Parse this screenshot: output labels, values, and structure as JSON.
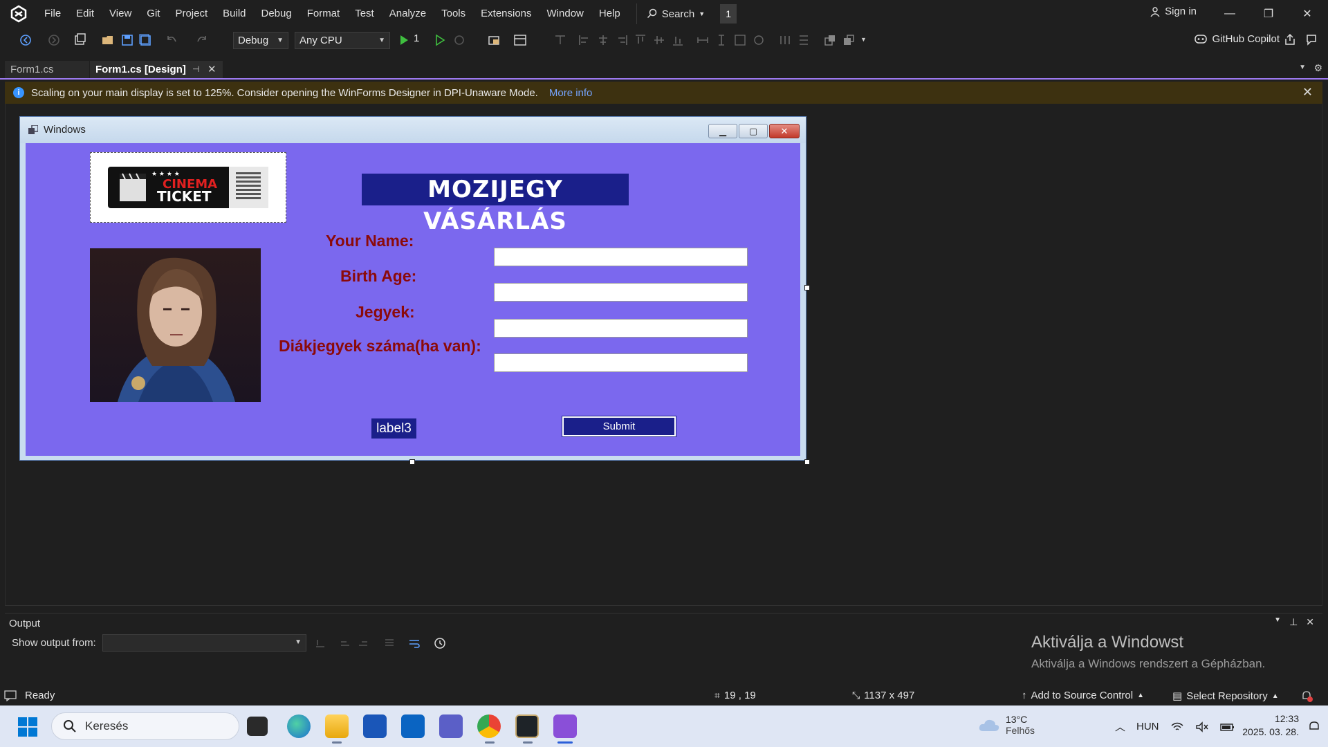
{
  "menubar": {
    "items": [
      "File",
      "Edit",
      "View",
      "Git",
      "Project",
      "Build",
      "Debug",
      "Format",
      "Test",
      "Analyze",
      "Tools",
      "Extensions",
      "Window",
      "Help"
    ],
    "search_label": "Search",
    "badge": "1",
    "signin": "Sign in"
  },
  "toolbar": {
    "config": "Debug",
    "platform": "Any CPU",
    "run_count": "1",
    "copilot": "GitHub Copilot"
  },
  "tabs": [
    {
      "label": "Form1.cs",
      "active": false
    },
    {
      "label": "Form1.cs [Design]",
      "active": true
    }
  ],
  "infobar": {
    "message": "Scaling on your main display is set to 125%. Consider opening the WinForms Designer in DPI-Unaware Mode.",
    "link": "More info"
  },
  "form": {
    "title": "Windows",
    "heading": "MOZIJEGY VÁSÁRLÁS",
    "ticket_image_text": {
      "line1": "CINEMA",
      "line2": "TICKET",
      "stars": "★ ★ ★ ★"
    },
    "fields": [
      {
        "label": "Your Name:",
        "value": ""
      },
      {
        "label": "Birth Age:",
        "value": ""
      },
      {
        "label": "Jegyek:",
        "value": ""
      },
      {
        "label": "Diákjegyek száma(ha van):",
        "value": ""
      }
    ],
    "status_label": "label3",
    "submit_label": "Submit"
  },
  "output": {
    "title": "Output",
    "show_from_label": "Show output from:",
    "show_from_value": ""
  },
  "watermark": {
    "line1": "Aktiválja a Windowst",
    "line2": "Aktiválja a Windows rendszert a Gépházban."
  },
  "statusbar": {
    "ready": "Ready",
    "position": "19 , 19",
    "size": "1137 x 497",
    "source_control": "Add to Source Control",
    "repository": "Select Repository"
  },
  "taskbar": {
    "search_placeholder": "Keresés",
    "weather_temp": "13°C",
    "weather_desc": "Felhős",
    "language": "HUN",
    "time": "12:33",
    "date": "2025. 03. 28."
  },
  "colors": {
    "form_bg": "#7b68ee",
    "label_color": "#8b0a0a",
    "accent_blue": "#1a1f8a",
    "vs_purple": "#9d7af0"
  }
}
